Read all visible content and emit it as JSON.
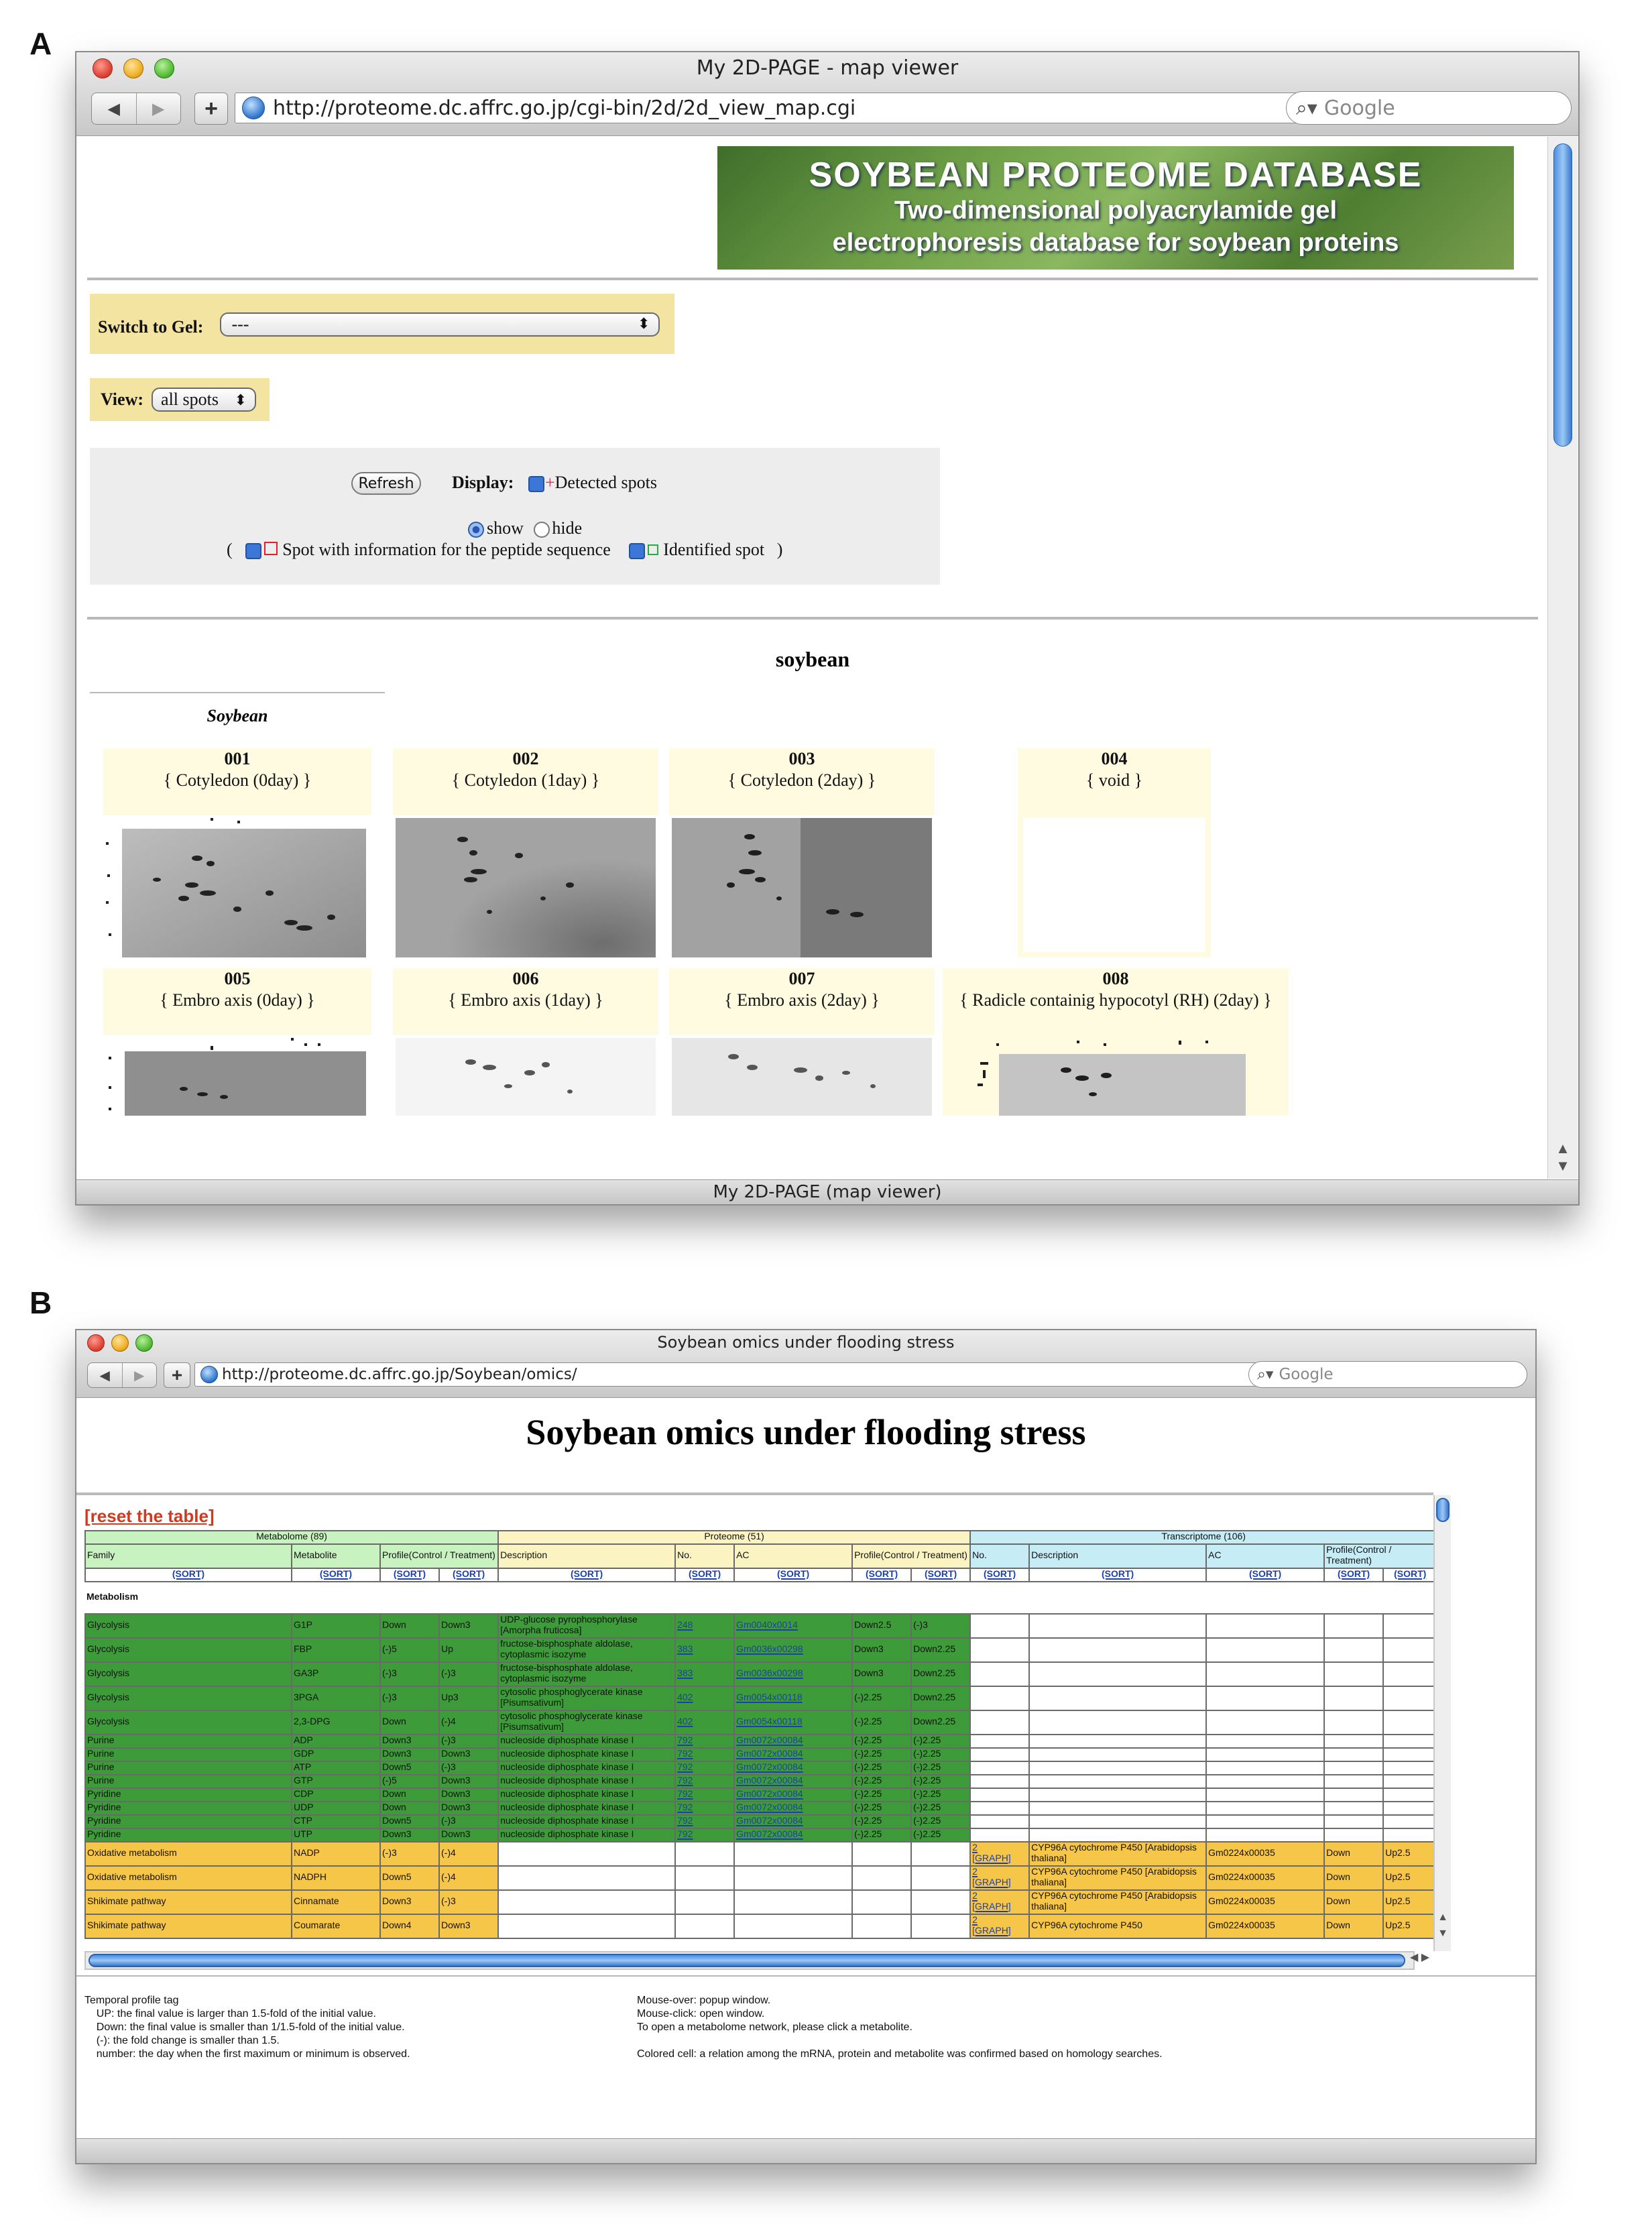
{
  "panel_labels": [
    "A",
    "B"
  ],
  "panel_a": {
    "window_title": "My 2D-PAGE - map viewer",
    "url": "http://proteome.dc.affrc.go.jp/cgi-bin/2d/2d_view_map.cgi",
    "search_placeholder": "Google",
    "status_text": "My 2D-PAGE (map viewer)",
    "banner_title": "SOYBEAN PROTEOME DATABASE",
    "banner_line1": "Two-dimensional polyacrylamide gel",
    "banner_line2": "electrophoresis database for soybean proteins",
    "switch_label": "Switch to Gel:",
    "switch_value": "---",
    "view_label": "View:",
    "view_value": "all spots",
    "refresh_label": "Refresh",
    "display_label": "Display:",
    "detected_label": "Detected spots",
    "show_label": "show",
    "hide_label": "hide",
    "paren_open": "(",
    "paren_close": ")",
    "peptide_label": "Spot with information for the peptide sequence",
    "identified_label": "Identified spot",
    "section_title": "soybean",
    "subsection_title": "Soybean",
    "gels": [
      {
        "num": "001",
        "name": "{ Cotyledon (0day) }"
      },
      {
        "num": "002",
        "name": "{ Cotyledon (1day) }"
      },
      {
        "num": "003",
        "name": "{ Cotyledon (2day) }"
      },
      {
        "num": "004",
        "name": "{ void }"
      },
      {
        "num": "005",
        "name": "{ Embro axis (0day) }"
      },
      {
        "num": "006",
        "name": "{ Embro axis (1day) }"
      },
      {
        "num": "007",
        "name": "{ Embro axis (2day) }"
      },
      {
        "num": "008",
        "name": "{ Radicle containig hypocotyl (RH) (2day) }"
      }
    ]
  },
  "panel_b": {
    "window_title": "Soybean omics under flooding stress",
    "url": "http://proteome.dc.affrc.go.jp/Soybean/omics/",
    "search_placeholder": "Google",
    "page_title": "Soybean omics under flooding stress",
    "reset_label": "[reset the table]",
    "groups": {
      "metabolome": "Metabolome (89)",
      "proteome": "Proteome (51)",
      "transcriptome": "Transcriptome (106)"
    },
    "columns": [
      "Family",
      "Metabolite",
      "Profile(Control / Treatment)",
      "Description",
      "No.",
      "AC",
      "Profile(Control / Treatment)",
      "No.",
      "Description",
      "AC",
      "Profile(Control / Treatment)"
    ],
    "sort_label": "(SORT)",
    "section_label": "Metabolism",
    "graph_label": "[GRAPH]",
    "rows": [
      {
        "c": "g",
        "family": "Glycolysis",
        "met": "G1P",
        "mp1": "Down",
        "mp2": "Down3",
        "desc": "UDP-glucose pyrophosphorylase [Amorpha fruticosa]",
        "no": "248",
        "ac": "Gm0040x0014",
        "pp1": "Down2.5",
        "pp2": "(-)3"
      },
      {
        "c": "g",
        "family": "Glycolysis",
        "met": "FBP",
        "mp1": "(-)5",
        "mp2": "Up",
        "desc": "fructose-bisphosphate aldolase, cytoplasmic isozyme",
        "no": "383",
        "ac": "Gm0036x00298",
        "pp1": "Down3",
        "pp2": "Down2.25"
      },
      {
        "c": "g",
        "family": "Glycolysis",
        "met": "GA3P",
        "mp1": "(-)3",
        "mp2": "(-)3",
        "desc": "fructose-bisphosphate aldolase, cytoplasmic isozyme",
        "no": "383",
        "ac": "Gm0036x00298",
        "pp1": "Down3",
        "pp2": "Down2.25"
      },
      {
        "c": "g",
        "family": "Glycolysis",
        "met": "3PGA",
        "mp1": "(-)3",
        "mp2": "Up3",
        "desc": "cytosolic phosphoglycerate kinase [Pisumsativum]",
        "no": "402",
        "ac": "Gm0054x00118",
        "pp1": "(-)2.25",
        "pp2": "Down2.25"
      },
      {
        "c": "g",
        "family": "Glycolysis",
        "met": "2,3-DPG",
        "mp1": "Down",
        "mp2": "(-)4",
        "desc": "cytosolic phosphoglycerate kinase [Pisumsativum]",
        "no": "402",
        "ac": "Gm0054x00118",
        "pp1": "(-)2.25",
        "pp2": "Down2.25"
      },
      {
        "c": "g",
        "family": "Purine",
        "met": "ADP",
        "mp1": "Down3",
        "mp2": "(-)3",
        "desc": "nucleoside diphosphate kinase I",
        "no": "792",
        "ac": "Gm0072x00084",
        "pp1": "(-)2.25",
        "pp2": "(-)2.25"
      },
      {
        "c": "g",
        "family": "Purine",
        "met": "GDP",
        "mp1": "Down3",
        "mp2": "Down3",
        "desc": "nucleoside diphosphate kinase I",
        "no": "792",
        "ac": "Gm0072x00084",
        "pp1": "(-)2.25",
        "pp2": "(-)2.25"
      },
      {
        "c": "g",
        "family": "Purine",
        "met": "ATP",
        "mp1": "Down5",
        "mp2": "(-)3",
        "desc": "nucleoside diphosphate kinase I",
        "no": "792",
        "ac": "Gm0072x00084",
        "pp1": "(-)2.25",
        "pp2": "(-)2.25"
      },
      {
        "c": "g",
        "family": "Purine",
        "met": "GTP",
        "mp1": "(-)5",
        "mp2": "Down3",
        "desc": "nucleoside diphosphate kinase I",
        "no": "792",
        "ac": "Gm0072x00084",
        "pp1": "(-)2.25",
        "pp2": "(-)2.25"
      },
      {
        "c": "g",
        "family": "Pyridine",
        "met": "CDP",
        "mp1": "Down",
        "mp2": "Down3",
        "desc": "nucleoside diphosphate kinase I",
        "no": "792",
        "ac": "Gm0072x00084",
        "pp1": "(-)2.25",
        "pp2": "(-)2.25"
      },
      {
        "c": "g",
        "family": "Pyridine",
        "met": "UDP",
        "mp1": "Down",
        "mp2": "Down3",
        "desc": "nucleoside diphosphate kinase I",
        "no": "792",
        "ac": "Gm0072x00084",
        "pp1": "(-)2.25",
        "pp2": "(-)2.25"
      },
      {
        "c": "g",
        "family": "Pyridine",
        "met": "CTP",
        "mp1": "Down5",
        "mp2": "(-)3",
        "desc": "nucleoside diphosphate kinase I",
        "no": "792",
        "ac": "Gm0072x00084",
        "pp1": "(-)2.25",
        "pp2": "(-)2.25"
      },
      {
        "c": "g",
        "family": "Pyridine",
        "met": "UTP",
        "mp1": "Down3",
        "mp2": "Down3",
        "desc": "nucleoside diphosphate kinase I",
        "no": "792",
        "ac": "Gm0072x00084",
        "pp1": "(-)2.25",
        "pp2": "(-)2.25"
      },
      {
        "c": "o",
        "family": "Oxidative metabolism",
        "met": "NADP",
        "mp1": "(-)3",
        "mp2": "(-)4",
        "tno": "2",
        "tdesc": "CYP96A cytochrome P450 [Arabidopsis thaliana]",
        "tac": "Gm0224x00035",
        "tp1": "Down",
        "tp2": "Up2.5"
      },
      {
        "c": "o",
        "family": "Oxidative metabolism",
        "met": "NADPH",
        "mp1": "Down5",
        "mp2": "(-)4",
        "tno": "2",
        "tdesc": "CYP96A cytochrome P450 [Arabidopsis thaliana]",
        "tac": "Gm0224x00035",
        "tp1": "Down",
        "tp2": "Up2.5"
      },
      {
        "c": "o",
        "family": "Shikimate pathway",
        "met": "Cinnamate",
        "mp1": "Down3",
        "mp2": "(-)3",
        "tno": "2",
        "tdesc": "CYP96A cytochrome P450 [Arabidopsis thaliana]",
        "tac": "Gm0224x00035",
        "tp1": "Down",
        "tp2": "Up2.5"
      },
      {
        "c": "o",
        "family": "Shikimate pathway",
        "met": "Coumarate",
        "mp1": "Down4",
        "mp2": "Down3",
        "tno": "2",
        "tdesc": "CYP96A cytochrome P450",
        "tac": "Gm0224x00035",
        "tp1": "Down",
        "tp2": "Up2.5"
      }
    ],
    "legend_left": "Temporal profile tag\n    UP: the final value is larger than 1.5-fold of the initial value.\n    Down: the final value is smaller than 1/1.5-fold of the initial value.\n    (-): the fold change is smaller than 1.5.\n    number: the day when the first maximum or minimum is observed.",
    "legend_right": "Mouse-over: popup window.\nMouse-click: open window.\nTo open a metabolome network, please click a metabolite.\n\nColored cell: a relation among the mRNA, protein and metabolite was confirmed based on homology searches."
  },
  "colors": {
    "metabolism_green": "#3e9b3a",
    "transcript_orange": "#f6c648",
    "form_yellow": "#f4e4a2",
    "reset_red": "#d03a20",
    "link_blue": "#1b3fae"
  }
}
